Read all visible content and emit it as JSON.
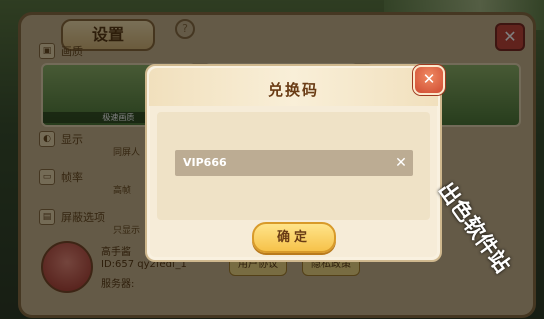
{
  "settings": {
    "title": "设置",
    "close": "✕",
    "help": "?",
    "sections": [
      {
        "label": "画质",
        "icon": "image-icon"
      },
      {
        "label": "显示",
        "icon": "display-icon"
      },
      {
        "label": "帧率",
        "icon": "framerate-icon"
      },
      {
        "label": "屏蔽选项",
        "icon": "block-icon"
      }
    ],
    "quality_options": [
      "极速画质",
      "",
      ""
    ],
    "sub_labels": [
      "同屏人",
      "高帧",
      "只显示"
    ],
    "profile": {
      "name": "高手酱",
      "id": "ID:657 qy2fedf_1",
      "server": "服务器:"
    },
    "buttons": [
      "用户协议",
      "隐私政策"
    ]
  },
  "redeem_dialog": {
    "title": "兑换码",
    "close": "✕",
    "code_value": "VIP666",
    "clear": "✕",
    "confirm": "确定"
  },
  "watermark": "出色软件站"
}
